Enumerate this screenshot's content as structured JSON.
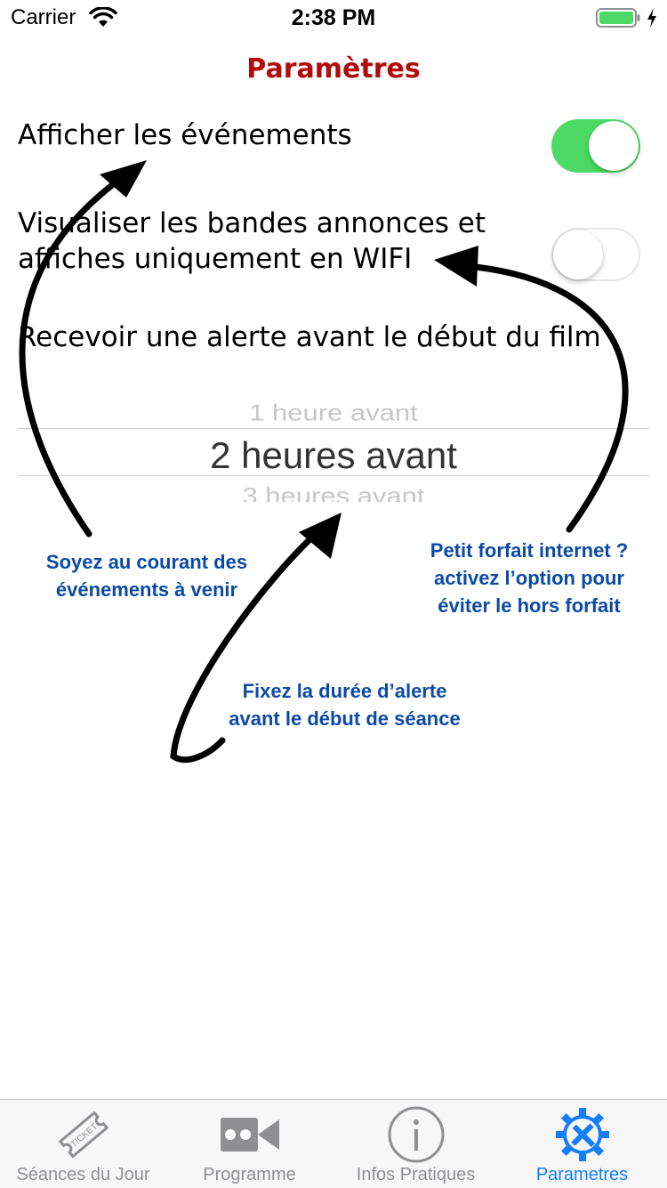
{
  "status_bar": {
    "carrier": "Carrier",
    "time": "2:38 PM"
  },
  "header": {
    "title": "Paramètres",
    "title_color": "#b30b0b"
  },
  "settings": {
    "events": {
      "label": "Afficher les événements",
      "enabled": true
    },
    "wifi_only": {
      "label_line1": "Visualiser les bandes annonces et",
      "label_line2": "affiches uniquement en WIFI",
      "enabled": false
    },
    "alert": {
      "label": "Recevoir une alerte avant le début du film"
    }
  },
  "picker": {
    "options": [
      "1 heure avant",
      "2 heures avant",
      "3 heures avant"
    ],
    "selected": "2 heures avant"
  },
  "annotations": {
    "events": {
      "line1": "Soyez au courant des",
      "line2": "événements à venir"
    },
    "wifi": {
      "line1": "Petit forfait internet ?",
      "line2": "activez l’option pour",
      "line3": "éviter le hors forfait"
    },
    "alert": {
      "line1": "Fixez la durée d’alerte",
      "line2": "avant le début de séance"
    }
  },
  "tabbar": {
    "tabs": [
      {
        "label": "Séances du Jour",
        "icon": "ticket-icon"
      },
      {
        "label": "Programme",
        "icon": "video-camera-icon"
      },
      {
        "label": "Infos Pratiques",
        "icon": "info-icon"
      },
      {
        "label": "Parametres",
        "icon": "settings-gear-wrench-icon",
        "active": true
      }
    ]
  },
  "colors": {
    "accent": "#147efb",
    "toggle_on": "#4cd964",
    "annotation_text": "#0b4aa6"
  }
}
